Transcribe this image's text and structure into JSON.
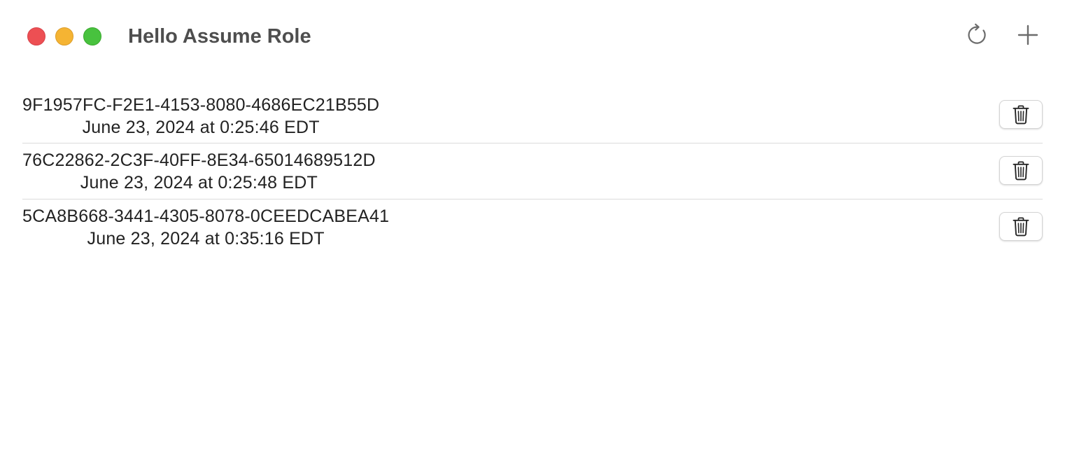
{
  "window": {
    "title": "Hello Assume Role",
    "traffic_lights": {
      "close_color": "#ed4f53",
      "minimize_color": "#f5b433",
      "zoom_color": "#48c23e"
    }
  },
  "toolbar": {
    "refresh_icon": "arrow-clockwise-icon",
    "add_icon": "plus-icon"
  },
  "sessions": [
    {
      "id": "9F1957FC-F2E1-4153-8080-4686EC21B55D",
      "date": "June 23, 2024 at 0:25:46 EDT",
      "delete_icon": "trash-icon"
    },
    {
      "id": "76C22862-2C3F-40FF-8E34-65014689512D",
      "date": "June 23, 2024 at 0:25:48 EDT",
      "delete_icon": "trash-icon"
    },
    {
      "id": "5CA8B668-3441-4305-8078-0CEEDCABEA41",
      "date": "June 23, 2024 at 0:35:16 EDT",
      "delete_icon": "trash-icon"
    }
  ]
}
